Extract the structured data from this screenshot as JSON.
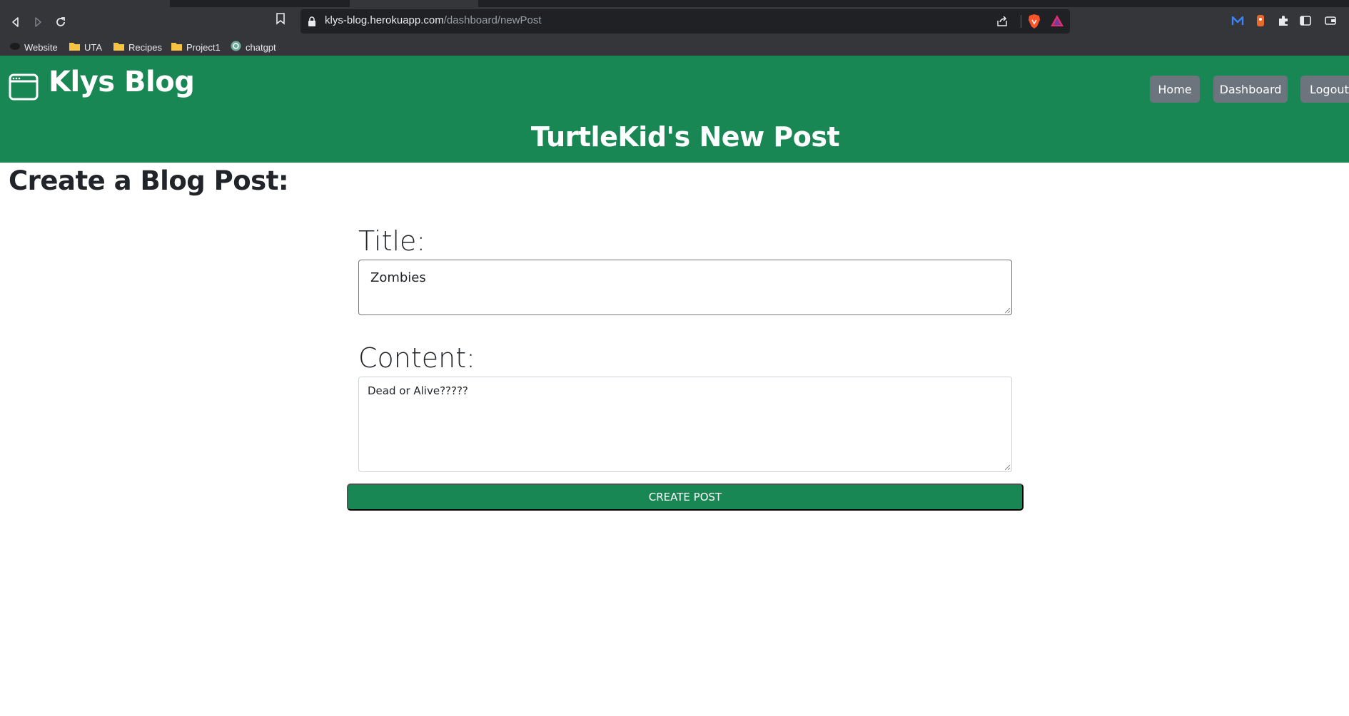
{
  "browser": {
    "url_host": "klys-blog.herokuapp.com",
    "url_path": "/dashboard/newPost",
    "bookmarks": [
      {
        "label": "Website",
        "icon": "site-icon"
      },
      {
        "label": "UTA",
        "icon": "folder-icon"
      },
      {
        "label": "Recipes",
        "icon": "folder-icon"
      },
      {
        "label": "Project1",
        "icon": "folder-icon"
      },
      {
        "label": "chatgpt",
        "icon": "chatgpt-icon"
      }
    ],
    "colors": {
      "chrome": "#35363a",
      "omnibox": "#202124"
    }
  },
  "site": {
    "brand": "Klys Blog",
    "nav": {
      "home": "Home",
      "dashboard": "Dashboard",
      "logout": "Logout"
    },
    "page_heading": "TurtleKid's New Post",
    "colors": {
      "header": "#198754",
      "nav_button": "#6c757d"
    }
  },
  "form": {
    "heading": "Create a Blog Post:",
    "title_label": "Title:",
    "title_value": "Zombies",
    "content_label": "Content:",
    "content_value": "Dead or Alive?????",
    "submit_label": "Create Post"
  }
}
